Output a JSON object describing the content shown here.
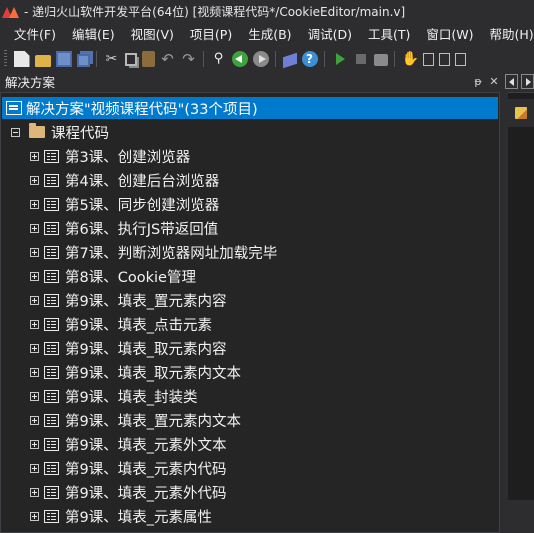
{
  "window": {
    "title": "- 递归火山软件开发平台(64位) [视频课程代码*/CookieEditor/main.v]"
  },
  "menu": [
    "文件(F)",
    "编辑(E)",
    "视图(V)",
    "项目(P)",
    "生成(B)",
    "调试(D)",
    "工具(T)",
    "窗口(W)",
    "帮助(H)"
  ],
  "toolbar": {
    "icons": [
      "new-file",
      "open-folder",
      "save",
      "save-all",
      "cut",
      "copy",
      "paste",
      "undo",
      "redo",
      "find",
      "navigate-back",
      "navigate-forward",
      "bookmark",
      "help",
      "run",
      "stop",
      "build",
      "hand",
      "window-tools"
    ]
  },
  "solution_explorer": {
    "title": "解决方案",
    "pin_glyph": "ᵽ",
    "close_glyph": "✕",
    "root_label": "解决方案\"视频课程代码\"(33个项目)",
    "folder_label": "课程代码",
    "items": [
      "第3课、创建浏览器",
      "第4课、创建后台浏览器",
      "第5课、同步创建浏览器",
      "第6课、执行JS带返回值",
      "第7课、判断浏览器网址加载完毕",
      "第8课、Cookie管理",
      "第9课、填表_置元素内容",
      "第9课、填表_点击元素",
      "第9课、填表_取元素内容",
      "第9课、填表_取元素内文本",
      "第9课、填表_封装类",
      "第9课、填表_置元素内文本",
      "第9课、填表_元素外文本",
      "第9课、填表_元素内代码",
      "第9课、填表_元素外代码",
      "第9课、填表_元素属性"
    ]
  },
  "colors": {
    "selection": "#007acc",
    "panel_bg": "#252526",
    "chrome_bg": "#2d2d30",
    "folder": "#dcb67a"
  }
}
